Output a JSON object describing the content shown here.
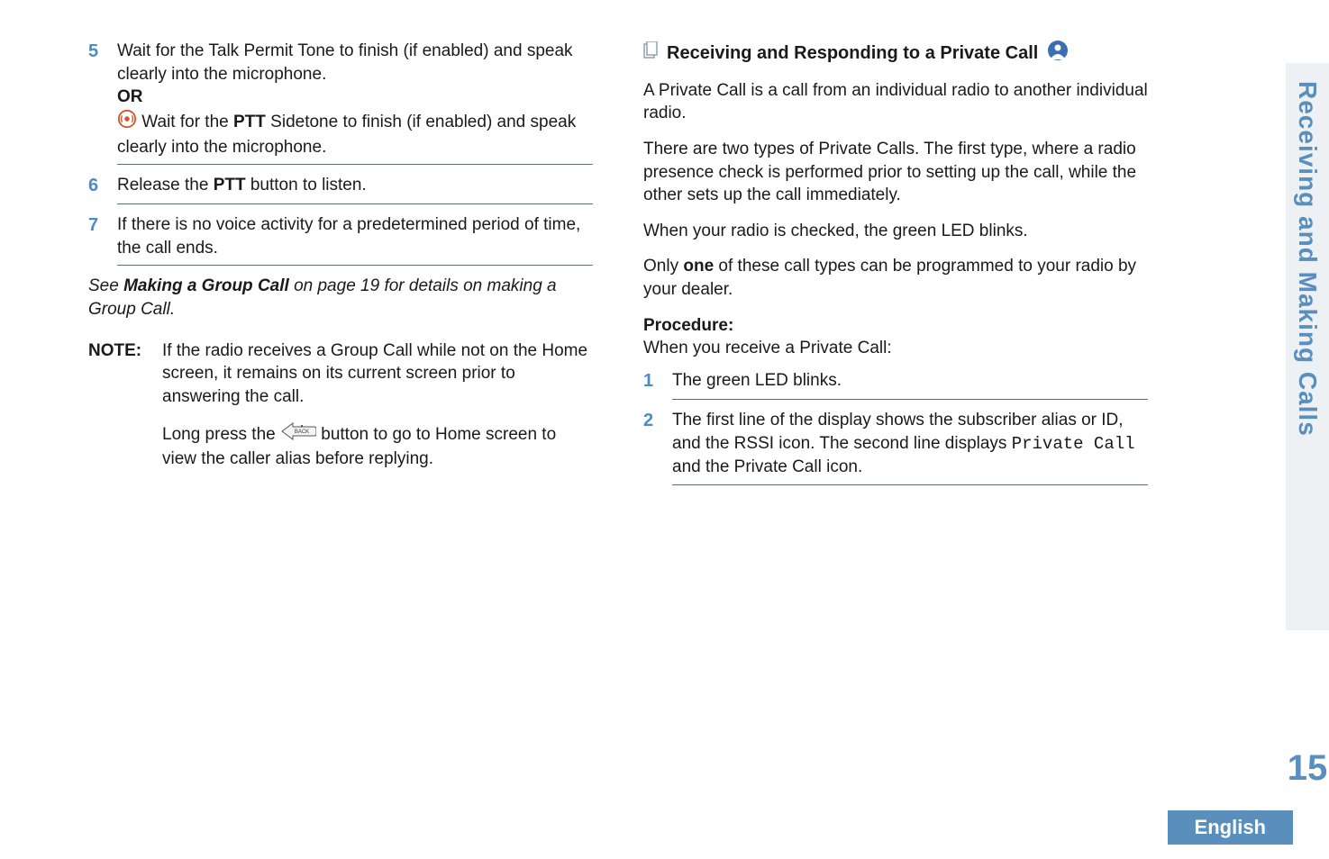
{
  "left": {
    "step5": {
      "num": "5",
      "line1a": "Wait for the Talk Permit Tone to finish (if enabled) and speak clearly into the microphone.",
      "or": "OR",
      "line2a": " Wait for the ",
      "ptt": "PTT",
      "line2b": " Sidetone to finish (if enabled) and speak clearly into the microphone."
    },
    "step6": {
      "num": "6",
      "text_a": "Release the ",
      "ptt": "PTT",
      "text_b": " button to listen."
    },
    "step7": {
      "num": "7",
      "text": "If there is no voice activity for a predetermined period of time, the call ends."
    },
    "see_a": "See ",
    "see_bold": "Making a Group Call",
    "see_b": " on page 19 for details on making a Group Call.",
    "note_label": "NOTE:",
    "note_p1": "If the radio receives a Group Call while not on the Home screen, it remains on its current screen prior to answering the call.",
    "note_p2a": "Long press the ",
    "note_p2b": " button to go to Home screen to view the caller alias before replying."
  },
  "right": {
    "heading": "Receiving and Responding to a Private Call",
    "p1": "A Private Call is a call from an individual radio to another individual radio.",
    "p2": "There are two types of Private Calls. The first type, where a radio presence check is performed prior to setting up the call, while the other sets up the call immediately.",
    "p3": "When your radio is checked, the green LED blinks.",
    "p4a": "Only ",
    "p4_bold": "one",
    "p4b": " of these call types can be programmed to your radio by your dealer.",
    "proc_label": "Procedure:",
    "proc_sub": "When you receive a Private Call:",
    "step1": {
      "num": "1",
      "text": "The green LED blinks."
    },
    "step2": {
      "num": "2",
      "text_a": "The first line of the display shows the subscriber alias or ID, and the RSSI icon. The second line displays ",
      "mono": "Private Call",
      "text_b": " and the Private Call icon."
    }
  },
  "side_title": "Receiving and Making Calls",
  "page_number": "15",
  "language": "English"
}
